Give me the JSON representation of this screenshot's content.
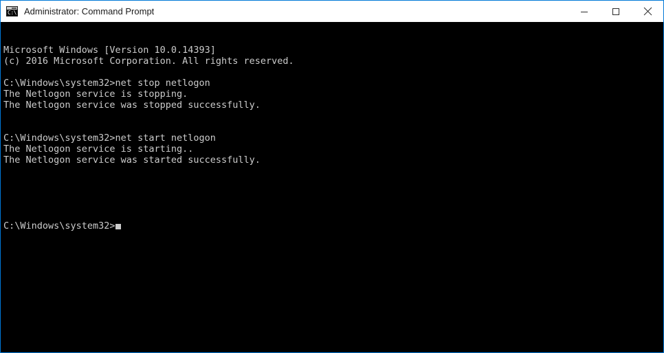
{
  "window": {
    "title": "Administrator: Command Prompt",
    "icon": "cmd-console-icon",
    "icon_text": "C:\\",
    "accent_color": "#0078d7",
    "controls": {
      "minimize_label": "Minimize",
      "maximize_label": "Maximize",
      "close_label": "Close"
    }
  },
  "console": {
    "background_color": "#000000",
    "text_color": "#cccccc",
    "cursor": "block",
    "lines": [
      "Microsoft Windows [Version 10.0.14393]",
      "(c) 2016 Microsoft Corporation. All rights reserved.",
      "",
      "C:\\Windows\\system32>net stop netlogon",
      "The Netlogon service is stopping.",
      "The Netlogon service was stopped successfully.",
      "",
      "",
      "C:\\Windows\\system32>net start netlogon",
      "The Netlogon service is starting..",
      "The Netlogon service was started successfully.",
      "",
      "",
      ""
    ],
    "prompt_line": "C:\\Windows\\system32>"
  }
}
